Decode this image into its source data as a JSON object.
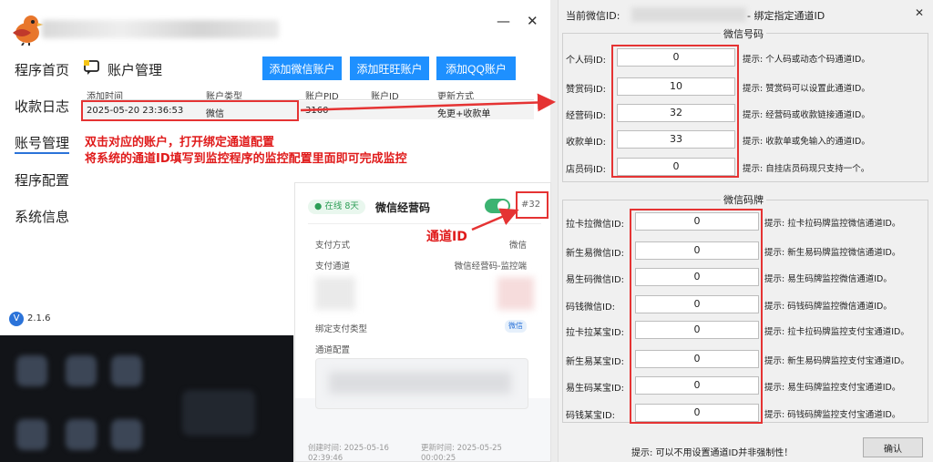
{
  "app": {
    "minimize_glyph": "—",
    "close_glyph": "✕",
    "version": "2.1.6",
    "version_badge": "V"
  },
  "nav": [
    {
      "label": "程序首页"
    },
    {
      "label": "收款日志"
    },
    {
      "label": "账号管理"
    },
    {
      "label": "程序配置"
    },
    {
      "label": "系统信息"
    }
  ],
  "accounts": {
    "title": "账户管理",
    "add_wechat": "添加微信账户",
    "add_wangwang": "添加旺旺账户",
    "add_qq": "添加QQ账户",
    "columns": [
      "添加时间",
      "账户类型",
      "账户PID",
      "账户ID",
      "更新方式"
    ],
    "row": [
      "2025-05-20 23:36:53",
      "微信",
      "3160",
      "",
      "免更+收款单"
    ]
  },
  "annotation": {
    "line1": "双击对应的账户，打开绑定通道配置",
    "line2": "将系统的通道ID填写到监控程序的监控配置里面即可完成监控",
    "channel_id": "通道ID"
  },
  "card": {
    "status": "在线 8天",
    "name": "微信经营码",
    "id_badge": "#32",
    "pay_method_label": "支付方式",
    "pay_method_value": "微信",
    "channel_label": "支付通道",
    "channel_value": "微信经营码-监控端",
    "bind_type_label": "绑定支付类型",
    "bind_type_value": "微信",
    "channel_config_label": "通道配置",
    "created": "创建时间: 2025-05-16 02:39:46",
    "updated": "更新时间: 2025-05-25 00:00:25"
  },
  "dialog": {
    "title_prefix": "当前微信ID:",
    "title_suffix": "- 绑定指定通道ID",
    "close_glyph": "✕",
    "group1_title": "微信号码",
    "group1_rows": [
      {
        "label": "个人码ID:",
        "value": "0",
        "hint": "提示: 个人码或动态个码通道ID。"
      },
      {
        "label": "赞赏码ID:",
        "value": "10",
        "hint": "提示: 赞赏码可以设置此通道ID。"
      },
      {
        "label": "经营码ID:",
        "value": "32",
        "hint": "提示: 经营码或收款链接通道ID。"
      },
      {
        "label": "收款单ID:",
        "value": "33",
        "hint": "提示: 收款单或免输入的通道ID。"
      },
      {
        "label": "店员码ID:",
        "value": "0",
        "hint": "提示: 自挂店员码现只支持一个。"
      }
    ],
    "group2_title": "微信码牌",
    "group2_rows": [
      {
        "label": "拉卡拉微信ID:",
        "value": "0",
        "hint": "提示: 拉卡拉码牌监控微信通道ID。"
      },
      {
        "label": "新生易微信ID:",
        "value": "0",
        "hint": "提示: 新生易码牌监控微信通道ID。"
      },
      {
        "label": "易生码微信ID:",
        "value": "0",
        "hint": "提示: 易生码牌监控微信通道ID。"
      },
      {
        "label": "码钱微信ID:",
        "value": "0",
        "hint": "提示: 码钱码牌监控微信通道ID。"
      },
      {
        "label": "拉卡拉某宝ID:",
        "value": "0",
        "hint": "提示: 拉卡拉码牌监控支付宝通道ID。"
      },
      {
        "label": "新生易某宝ID:",
        "value": "0",
        "hint": "提示: 新生易码牌监控支付宝通道ID。"
      },
      {
        "label": "易生码某宝ID:",
        "value": "0",
        "hint": "提示: 易生码牌监控支付宝通道ID。"
      },
      {
        "label": "码钱某宝ID:",
        "value": "0",
        "hint": "提示: 码钱码牌监控支付宝通道ID。"
      }
    ],
    "footer_hint": "提示: 可以不用设置通道ID并非强制性！",
    "confirm": "确认"
  },
  "colors": {
    "accent": "#1e90ff",
    "annotation": "#e01b1b",
    "toggle": "#3cb371"
  }
}
